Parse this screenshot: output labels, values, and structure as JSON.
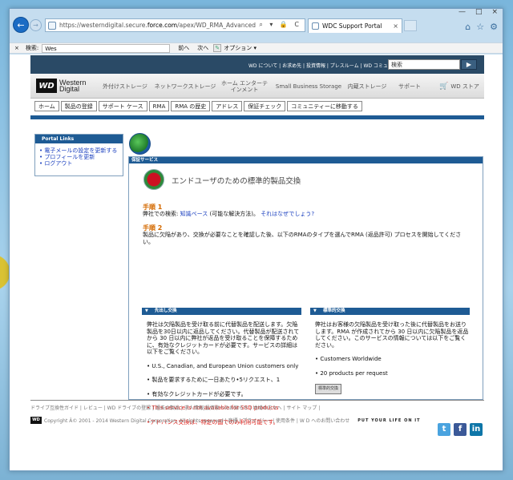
{
  "browser": {
    "url_prefix": "https://westerndigital.secure.",
    "url_domain": "force.com",
    "url_path": "/apex/WD_RMA_Advanced",
    "addr_controls": "⌕ ▾ 🔒 C",
    "tab_title": "WDC Support Portal",
    "tab_close": "×",
    "win_controls": [
      "—",
      "□",
      "×"
    ],
    "toolbar_icons": [
      "⌂",
      "☆",
      "⚙"
    ],
    "back_glyph": "←",
    "forward_glyph": "→"
  },
  "findbar": {
    "close": "×",
    "label": "検索:",
    "value": "Wes",
    "prev": "前へ",
    "next": "次へ",
    "pen_glyph": "✎",
    "options": "オプション ▾"
  },
  "site": {
    "top_links": "WD について | お求め先 | 投資情報 | プレスルーム | WD コミュニティ",
    "search_placeholder": "検索",
    "search_go": "▶",
    "logo_mark": "WD",
    "logo_line1": "Western",
    "logo_line2": "Digital",
    "nav": [
      "外付けストレージ",
      "ネットワークストレージ",
      "ホーム エンターテインメント",
      "Small Business Storage",
      "内蔵ストレージ",
      "サポート",
      "WD ストア"
    ],
    "subtabs": [
      "ホーム",
      "製品の登録",
      "サポート ケース",
      "RMA",
      "RMA の歴史",
      "アドレス",
      "保証チェック",
      "コミュニティーに移動する"
    ]
  },
  "portal": {
    "heading": "Portal Links",
    "links": [
      "電子メールの設定を更新する",
      "プロフィールを更新",
      "ログアウト"
    ]
  },
  "main": {
    "header": "保証サービス",
    "title": "エンドユーザのための標準的製品交換",
    "step1_heading": "手順 1",
    "step1_text": "弊社での検索:",
    "step1_link": "知識ベース",
    "step1_after": "(可能な解決方法)。",
    "step1_why": "それはなぜでしょう?",
    "step2_heading": "手順 2",
    "step2_text": "製品に欠陥があり、交換が必要なことを確認した後、以下のRMAのタイプを選んでRMA (返品許可) プロセスを開始してください。",
    "left": {
      "heading": "先出し交換",
      "intro": "弊社は欠陥製品を受け取る前に代替製品を配送します。欠陥製品を30日以内に返品してください。代替製品が配送されてから 30 日以内に弊社が返品を受け取ることを保障するために、有効なクレジットカードが必要です。サービスの詳細は以下をご覧ください。",
      "b1": "• U.S., Canadian, and European Union customers only",
      "b2": "• 製品を要求するために一日あたり•5リクエスト、1",
      "b3": "• 有効なクレジットカードが必要です。",
      "b4": "• This service is not available for SSD products",
      "b5": "•アドバンス交換は、特定の国でのみ利用可能です。"
    },
    "right": {
      "heading": "標準的交換",
      "intro": "弊社はお客様の欠陥製品を受け取った後に代替製品をお送りします。RMA が作成されてから 30 日以内に欠陥製品を返品してください。このサービスの情報については以下をご覧ください。",
      "b1": "• Customers Worldwide",
      "b2": "• 20 products per request",
      "button": "標準的交換"
    }
  },
  "footer": {
    "links": "ドライブ互換性ガイド | レビュー | WD ドライブの登録 | 過去の製品 | 求人情報|投資家へのお知らせ | 地域の方々へ | サイト マップ |",
    "logo_mark": "WD",
    "copyright": "Copyright Â© 2001 - 2014 Western Digital Corporation, All rights reserved | 商標 | プライバシー | 使用条件 | W D へのお問い合わせ",
    "tagline": "PUT YOUR LIFE ON IT",
    "social": [
      "t",
      "f",
      "in"
    ]
  },
  "colors": {
    "accent_blue": "#1e5b94",
    "top_bar": "#2a4a66",
    "step_orange": "#d46a00",
    "link_blue": "#1a3fbf",
    "warning_red": "#e0201a"
  }
}
